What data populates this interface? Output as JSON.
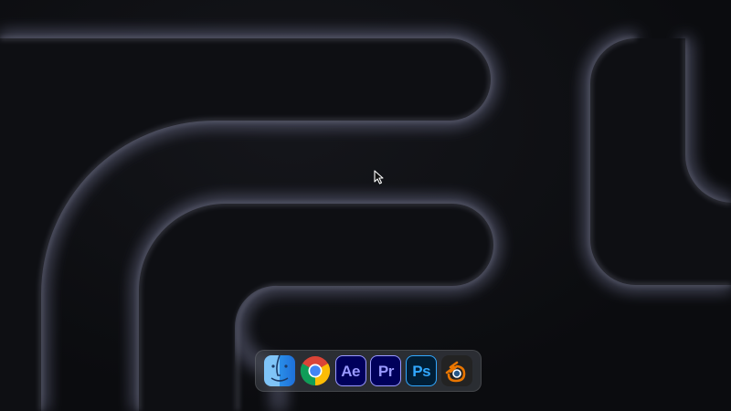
{
  "desktop": {
    "wallpaper": "dark-abstract-glow-maze",
    "background_color": "#0b0c0f",
    "glow_color": "#a8acd8"
  },
  "cursor": {
    "icon": "arrow-cursor-icon"
  },
  "dock": {
    "apps": [
      {
        "id": "finder",
        "icon": "finder-icon",
        "label": ""
      },
      {
        "id": "chrome",
        "icon": "chrome-icon",
        "label": ""
      },
      {
        "id": "after-effects",
        "icon": "after-effects-icon",
        "label": "Ae",
        "color": "#9999ff",
        "bg": "#00005b"
      },
      {
        "id": "premiere-pro",
        "icon": "premiere-pro-icon",
        "label": "Pr",
        "color": "#9999ff",
        "bg": "#00005b"
      },
      {
        "id": "photoshop",
        "icon": "photoshop-icon",
        "label": "Ps",
        "color": "#31a8ff",
        "bg": "#001e36"
      },
      {
        "id": "blender",
        "icon": "blender-icon",
        "label": "",
        "color": "#ea7600"
      }
    ]
  }
}
